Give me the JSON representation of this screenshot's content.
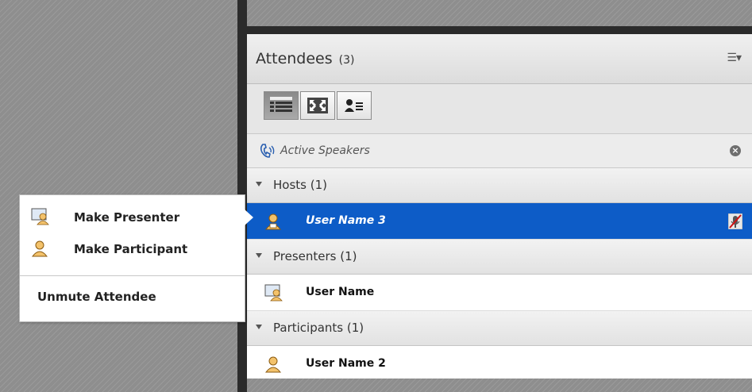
{
  "attendees": {
    "title": "Attendees",
    "count": "(3)",
    "menu_icon": "list-menu-icon"
  },
  "toolbar": {
    "buttons": [
      {
        "name": "list-view-icon",
        "active": true
      },
      {
        "name": "fullscreen-icon",
        "active": false
      },
      {
        "name": "attendee-status-icon",
        "active": false
      }
    ]
  },
  "active_speakers": {
    "label": "Active Speakers"
  },
  "groups": [
    {
      "label": "Hosts (1)",
      "users": [
        {
          "name": "User Name 3",
          "role": "host",
          "selected": true
        }
      ]
    },
    {
      "label": "Presenters (1)",
      "users": [
        {
          "name": "User Name",
          "role": "presenter",
          "selected": false
        }
      ]
    },
    {
      "label": "Participants (1)",
      "users": [
        {
          "name": "User Name 2",
          "role": "participant",
          "selected": false
        }
      ]
    }
  ],
  "context_menu": {
    "items": [
      {
        "label": "Make Presenter",
        "icon": "presenter-icon"
      },
      {
        "label": "Make Participant",
        "icon": "participant-icon"
      },
      {
        "label": "Unmute Attendee",
        "icon": ""
      }
    ]
  },
  "colors": {
    "selection": "#0d5cc7",
    "background_hatch": "#8e8e8e"
  }
}
